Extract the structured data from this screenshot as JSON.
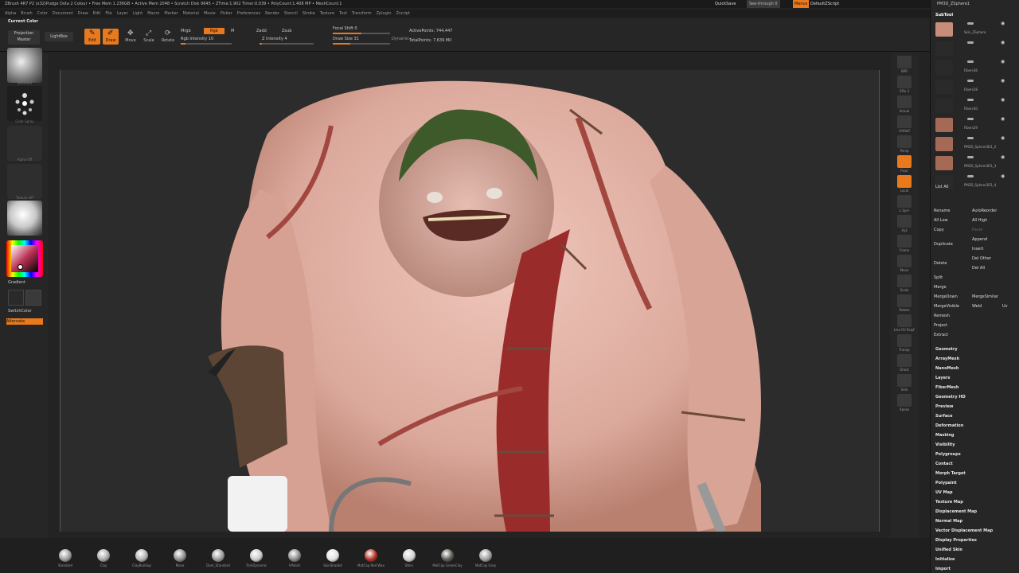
{
  "title_bar": {
    "text": "ZBrush 4R7 P2 (x32)Pudge Dota 2 Colour   • Free Mem 1.236GB • Active Mem 2048 • Scratch Disk 9645 • ZTime:1.902 Timer:0.039 • PolyCount:1.408 MP • MeshCount:1",
    "quicksave": "QuickSave",
    "see_through": "See-through  0",
    "menus_btn": "Menus",
    "default_zscript": "DefaultZScript"
  },
  "menu_bar": [
    "Alpha",
    "Brush",
    "Color",
    "Document",
    "Draw",
    "Edit",
    "File",
    "Layer",
    "Light",
    "Macro",
    "Marker",
    "Material",
    "Movie",
    "Picker",
    "Preferences",
    "Render",
    "Stencil",
    "Stroke",
    "Texture",
    "Tool",
    "Transform",
    "Zplugin",
    "Zscript"
  ],
  "toolbar": {
    "current_color": "Current Color",
    "projection_master": "Projection Master",
    "lightbox": "LightBox",
    "edit": "Edit",
    "draw": "Draw",
    "move": "Move",
    "scale": "Scale",
    "rotate": "Rotate",
    "mrgb": "Mrgb",
    "rgb": "Rgb",
    "m": "M",
    "rgb_intensity": "Rgb Intensity 10",
    "zadd": "Zadd",
    "zsub": "Zsub",
    "z_intensity": "Z Intensity 4",
    "focal_shift": "Focal Shift 0",
    "draw_size": "Draw Size 31",
    "dynamic": "Dynamic",
    "active_points": "ActivePoints: 744,447",
    "total_points": "TotalPoints: 7.639 Mil",
    "rgb_intensity_value": 10,
    "z_intensity_value": 4,
    "draw_size_value": 31
  },
  "left_shelf": {
    "standard": "Standard",
    "color_spray": "Color Spray",
    "alpha_off": "Alpha Off",
    "texture_off": "Texture Off",
    "skinshade": "SkinShade4",
    "gradient": "Gradient",
    "switch_color": "SwitchColor",
    "alternate": "Alternate"
  },
  "right_shelf": [
    "BPR",
    "SPix 3",
    "Actual",
    "AAHalf",
    "Persp",
    "Floor",
    "Local",
    "L.Sym",
    "Xyz",
    "Frame",
    "Move",
    "Scale",
    "Rotate",
    "Line Fill PolyF",
    "Transp",
    "Ghost",
    "Solo",
    "Xpose"
  ],
  "subtool": {
    "header": "SubTool",
    "top_label": "PM3D_ZSphere1",
    "items": [
      {
        "name": "Skin_ZSphere"
      },
      {
        "name": ""
      },
      {
        "name": "Fibers36"
      },
      {
        "name": "Fibers28"
      },
      {
        "name": "Fibers30"
      },
      {
        "name": "Fibers29"
      },
      {
        "name": "PM3D_Sphere3D1_2"
      },
      {
        "name": "PM3D_Sphere3D1_3"
      },
      {
        "name": "PM3D_Sphere3D1_4"
      }
    ],
    "list_all": "List All"
  },
  "subtool_actions": {
    "rename": "Rename",
    "autoreorder": "AutoReorder",
    "all_low": "All Low",
    "all_high": "All High",
    "copy": "Copy",
    "paste": "Paste",
    "duplicate": "Duplicate",
    "append": "Append",
    "insert": "Insert",
    "delete": "Delete",
    "del_other": "Del Other",
    "del_all": "Del All",
    "split": "Split",
    "merge": "Merge",
    "merge_down": "MergeDown",
    "merge_similar": "MergeSimilar",
    "merge_visible": "MergeVisible",
    "weld": "Weld",
    "uv": "Uv",
    "remesh": "Remesh",
    "project": "Project",
    "extract": "Extract"
  },
  "tool_menus": [
    "Geometry",
    "ArrayMesh",
    "NanoMesh",
    "Layers",
    "FiberMesh",
    "Geometry HD",
    "Preview",
    "Surface",
    "Deformation",
    "Masking",
    "Visibility",
    "Polygroups",
    "Contact",
    "Morph Target",
    "Polypaint",
    "UV Map",
    "Texture Map",
    "Displacement Map",
    "Normal Map",
    "Vector Displacement Map",
    "Display Properties",
    "Unified Skin",
    "Initialize",
    "Import"
  ],
  "bottom_brushes": [
    {
      "name": "Standard",
      "color": "#9a9a9a"
    },
    {
      "name": "Clay",
      "color": "#a8a8a8"
    },
    {
      "name": "ClayBuildup",
      "color": "#b0b0b0"
    },
    {
      "name": "Move",
      "color": "#8a8a8a"
    },
    {
      "name": "Dam_Standard",
      "color": "#999999"
    },
    {
      "name": "TrimDynamic",
      "color": "#c8c8c8"
    },
    {
      "name": "hPolish",
      "color": "#888888"
    },
    {
      "name": "SkinShade4",
      "color": "#e0e0e0"
    },
    {
      "name": "MatCap Red Wax",
      "color": "#b03020"
    },
    {
      "name": "Blinn",
      "color": "#cfcfcf"
    },
    {
      "name": "MatCap GreenClay",
      "color": "#585a52"
    },
    {
      "name": "MatCap Gray",
      "color": "#9c9c9c"
    }
  ],
  "colors": {
    "accent": "#e8791c",
    "background": "#232323",
    "skin": "#e3b3a6",
    "wound": "#9a2b2b"
  }
}
